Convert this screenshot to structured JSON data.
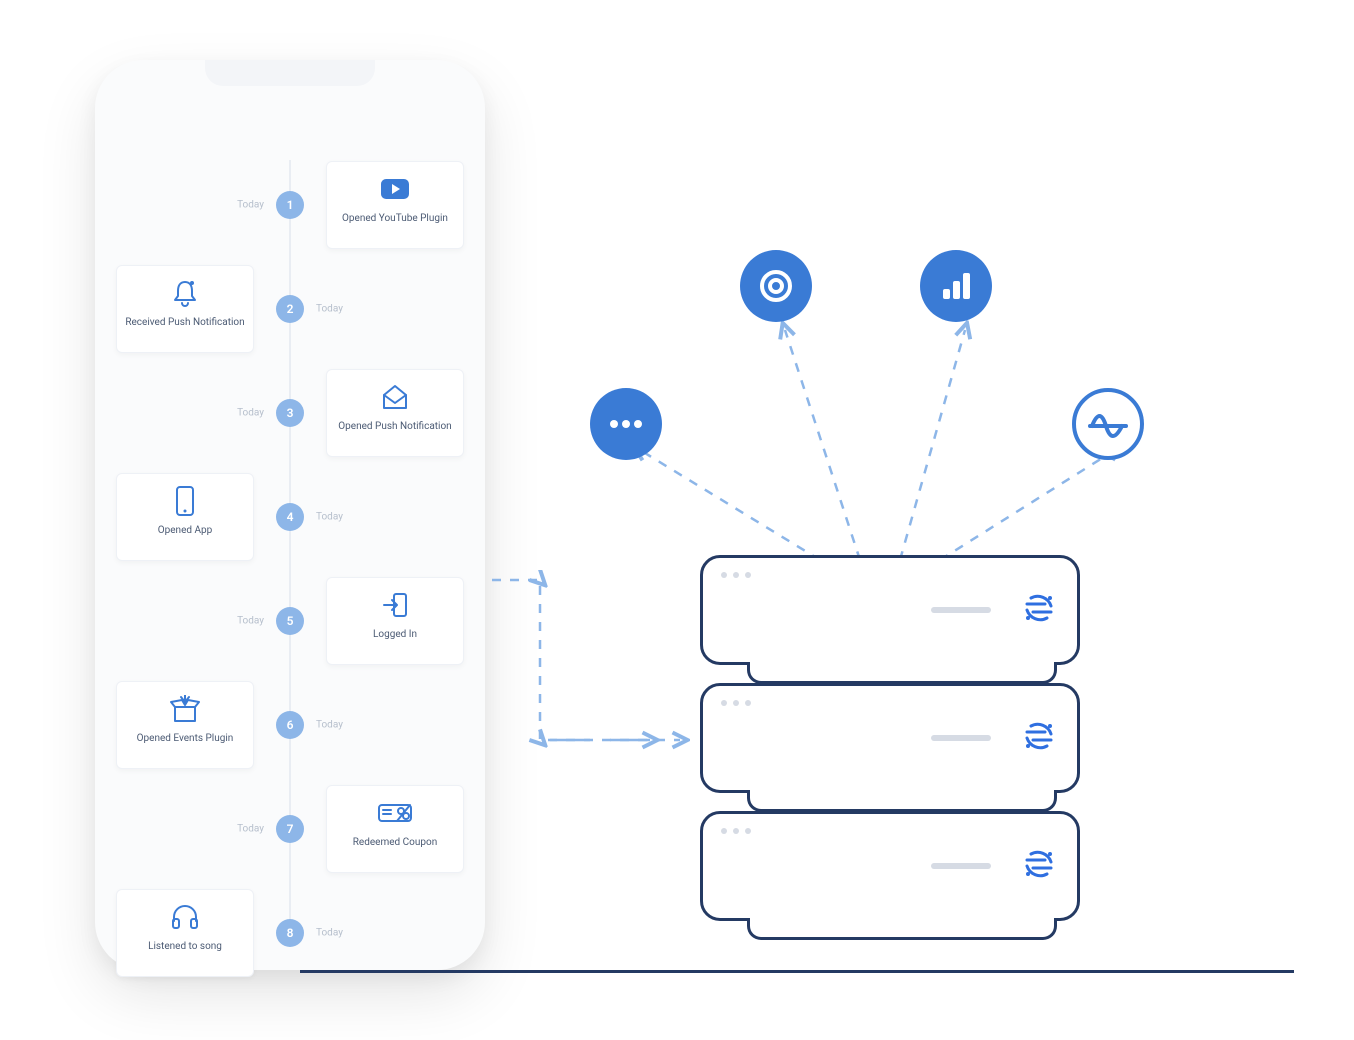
{
  "timeline": {
    "date_label": "Today",
    "events": [
      {
        "num": "1",
        "side": "right",
        "icon": "youtube",
        "label": "Opened YouTube Plugin"
      },
      {
        "num": "2",
        "side": "left",
        "icon": "bell",
        "label": "Received Push Notification"
      },
      {
        "num": "3",
        "side": "right",
        "icon": "envelope-open",
        "label": "Opened Push Notification"
      },
      {
        "num": "4",
        "side": "left",
        "icon": "phone-outline",
        "label": "Opened App"
      },
      {
        "num": "5",
        "side": "right",
        "icon": "login",
        "label": "Logged In"
      },
      {
        "num": "6",
        "side": "left",
        "icon": "box-open",
        "label": "Opened Events Plugin"
      },
      {
        "num": "7",
        "side": "right",
        "icon": "coupon",
        "label": "Redeemed Coupon"
      },
      {
        "num": "8",
        "side": "left",
        "icon": "headphones",
        "label": "Listened to song"
      }
    ]
  },
  "destinations": [
    {
      "name": "more",
      "style": "solid"
    },
    {
      "name": "circle-target",
      "style": "solid"
    },
    {
      "name": "analytics",
      "style": "solid"
    },
    {
      "name": "amplitude",
      "style": "outline"
    }
  ],
  "server_count": 3
}
